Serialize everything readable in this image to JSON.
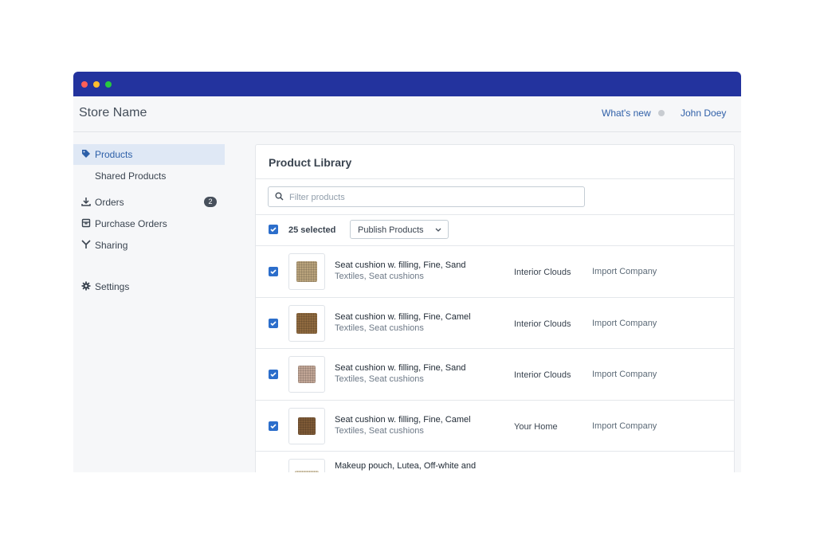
{
  "header": {
    "store_name": "Store Name",
    "whats_new": "What's new",
    "user_name": "John Doey"
  },
  "sidebar": {
    "items": [
      {
        "label": "Products",
        "icon": "tag-icon",
        "active": true
      },
      {
        "label": "Shared Products",
        "icon": "",
        "active": false
      },
      {
        "label": "Orders",
        "icon": "download-icon",
        "badge": "2"
      },
      {
        "label": "Purchase Orders",
        "icon": "box-icon"
      },
      {
        "label": "Sharing",
        "icon": "share-icon"
      },
      {
        "label": "Settings",
        "icon": "gear-icon"
      }
    ]
  },
  "library": {
    "title": "Product Library",
    "search_placeholder": "Filter products",
    "selected_label": "25 selected",
    "publish_button": "Publish Products",
    "rows": [
      {
        "name": "Seat cushion w. filling, Fine, Sand",
        "category": "Textiles, Seat cushions",
        "supplier": "Interior Clouds",
        "importer": "Import Company",
        "checked": true,
        "thumb_color": "#b9a37c"
      },
      {
        "name": "Seat cushion w. filling, Fine, Camel",
        "category": "Textiles, Seat cushions",
        "supplier": "Interior Clouds",
        "importer": "Import Company",
        "checked": true,
        "thumb_color": "#8f6a3f"
      },
      {
        "name": "Seat cushion w. filling, Fine, Sand",
        "category": "Textiles, Seat cushions",
        "supplier": "Interior Clouds",
        "importer": "Import Company",
        "checked": true,
        "thumb_color": "#c2a696"
      },
      {
        "name": "Seat cushion w. filling, Fine, Camel",
        "category": "Textiles, Seat cushions",
        "supplier": "Your Home",
        "importer": "Import Company",
        "checked": true,
        "thumb_color": "#7e5a36"
      },
      {
        "name": "Makeup pouch, Lutea, Off-white and",
        "category": "",
        "supplier": "",
        "importer": "",
        "checked": true,
        "thumb_color": "#d8cdb5"
      }
    ]
  },
  "colors": {
    "titlebar": "#23339e",
    "accent": "#2c6ecb",
    "link": "#3060a8"
  }
}
